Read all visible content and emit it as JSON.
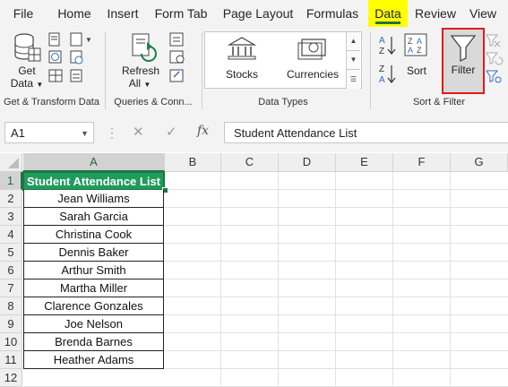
{
  "tabs": [
    "File",
    "Home",
    "Insert",
    "Form Tab",
    "Page Layout",
    "Formulas",
    "Data",
    "Review",
    "View"
  ],
  "active_tab": "Data",
  "ribbon": {
    "get_data": [
      "Get",
      "Data"
    ],
    "refresh_all": [
      "Refresh",
      "All"
    ],
    "stocks": "Stocks",
    "currencies": "Currencies",
    "sort": "Sort",
    "filter": "Filter",
    "groups": {
      "get_transform": "Get & Transform Data",
      "queries": "Queries & Conn...",
      "data_types": "Data Types",
      "sort_filter": "Sort & Filter"
    }
  },
  "formula_bar": {
    "name_box": "A1",
    "fx": "fx",
    "content": "Student Attendance List"
  },
  "sheet": {
    "columns": [
      "A",
      "B",
      "C",
      "D",
      "E",
      "F",
      "G"
    ],
    "rows": [
      "1",
      "2",
      "3",
      "4",
      "5",
      "6",
      "7",
      "8",
      "9",
      "10",
      "11",
      "12"
    ],
    "selected_cell": "A1",
    "header": "Student Attendance List",
    "students": [
      "Jean Williams",
      "Sarah Garcia",
      "Christina Cook",
      "Dennis Baker",
      "Arthur Smith",
      "Martha Miller",
      "Clarence Gonzales",
      "Joe Nelson",
      "Brenda Barnes",
      "Heather Adams"
    ]
  },
  "colors": {
    "excel_green": "#217346",
    "header_fill": "#1e9c5b",
    "highlight": "#ffff00",
    "filter_border": "#e21a1a"
  }
}
